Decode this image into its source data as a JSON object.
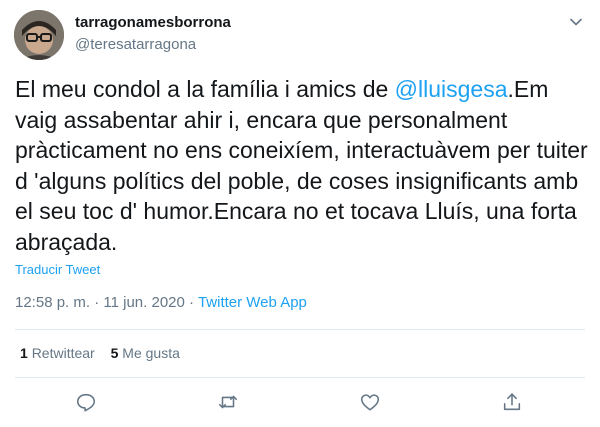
{
  "user": {
    "display_name": "tarragonamesborrona",
    "handle": "@teresatarragona"
  },
  "tweet": {
    "text_before": "El meu condol a la família i amics de ",
    "mention": "@lluisgesa",
    "text_after": ".Em vaig assabentar ahir i, encara que personalment pràcticament no ens coneixíem, interactuàvem per tuiter d 'alguns polítics del poble, de coses insignificants amb el seu toc d' humor.Encara no et tocava Lluís, una forta abraçada.",
    "translate_label": "Traducir Tweet",
    "time": "12:58 p. m.",
    "separator": "·",
    "date": "11 jun. 2020",
    "source": "Twitter Web App"
  },
  "stats": {
    "retweets_count": "1",
    "retweets_label": "Retwittear",
    "likes_count": "5",
    "likes_label": "Me gusta"
  },
  "colors": {
    "accent": "#1da1f2",
    "secondary_text": "#657786",
    "divider": "#e1e8ed"
  },
  "icons": [
    "more-caret-icon",
    "reply-icon",
    "retweet-icon",
    "like-icon",
    "share-icon"
  ]
}
